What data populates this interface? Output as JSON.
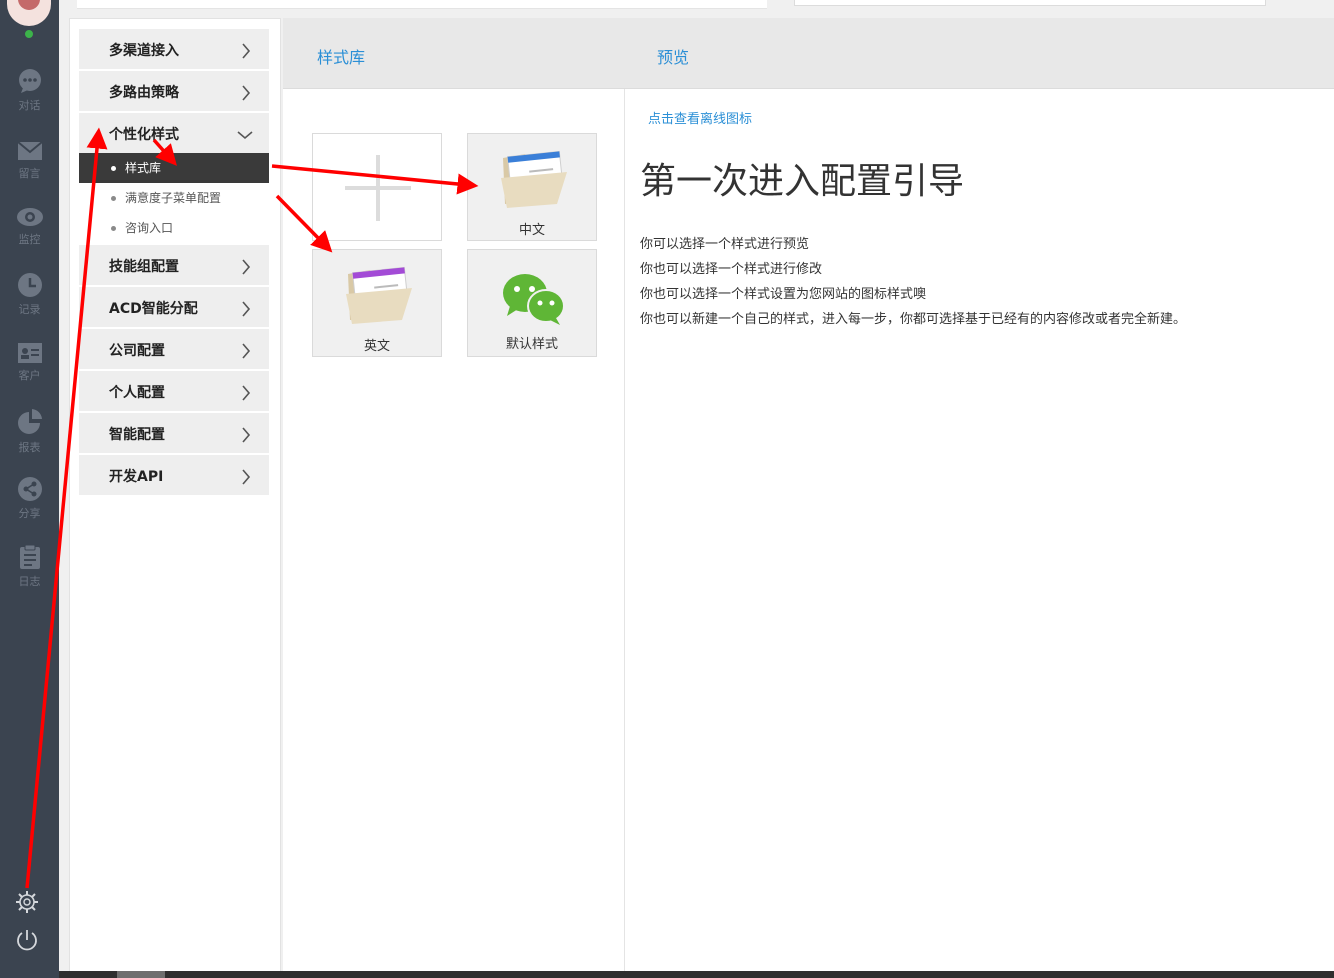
{
  "rail": {
    "items": [
      {
        "label": "对话",
        "icon": "chat-bubble-icon"
      },
      {
        "label": "留言",
        "icon": "envelope-icon"
      },
      {
        "label": "监控",
        "icon": "eye-icon"
      },
      {
        "label": "记录",
        "icon": "clock-icon"
      },
      {
        "label": "客户",
        "icon": "contact-card-icon"
      },
      {
        "label": "报表",
        "icon": "pie-chart-icon"
      },
      {
        "label": "分享",
        "icon": "share-icon"
      },
      {
        "label": "日志",
        "icon": "clipboard-icon"
      }
    ],
    "online_color": "#3cb34a",
    "background": "#3b4450"
  },
  "menu": {
    "items": [
      {
        "label": "多渠道接入"
      },
      {
        "label": "多路由策略"
      },
      {
        "label": "个性化样式",
        "expanded": true
      },
      {
        "label": "技能组配置"
      },
      {
        "label": "ACD智能分配"
      },
      {
        "label": "公司配置"
      },
      {
        "label": "个人配置"
      },
      {
        "label": "智能配置"
      },
      {
        "label": "开发API"
      }
    ],
    "sub_items": [
      {
        "label": "样式库",
        "active": true
      },
      {
        "label": "满意度子菜单配置"
      },
      {
        "label": "咨询入口"
      }
    ]
  },
  "style_library": {
    "title": "样式库",
    "tiles": [
      {
        "label": "",
        "icon": "add-plus-icon"
      },
      {
        "label": "中文",
        "icon": "folder-blue-icon"
      },
      {
        "label": "英文",
        "icon": "folder-purple-icon"
      },
      {
        "label": "默认样式",
        "icon": "wechat-icon"
      }
    ]
  },
  "preview": {
    "title": "预览",
    "offline_link": "点击查看离线图标",
    "heading": "第一次进入配置引导",
    "lines": [
      "你可以选择一个样式进行预览",
      "你也可以选择一个样式进行修改",
      "你也可以选择一个样式设置为您网站的图标样式噢",
      "你也可以新建一个自己的样式，进入每一步，你都可选择基于已经有的内容修改或者完全新建。"
    ]
  },
  "colors": {
    "accent": "#2b8fd6",
    "annotation_arrow": "#ff0000",
    "active_sub_item": "#3a3a3a"
  }
}
